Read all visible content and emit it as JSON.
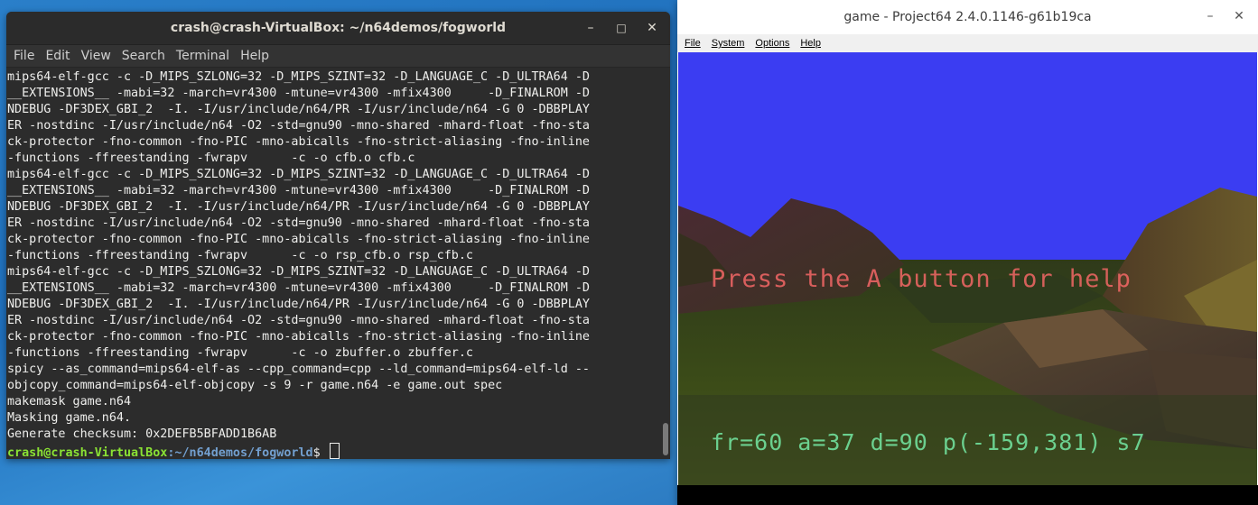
{
  "terminal": {
    "title": "crash@crash-VirtualBox: ~/n64demos/fogworld",
    "menu": [
      "File",
      "Edit",
      "View",
      "Search",
      "Terminal",
      "Help"
    ],
    "lines": [
      "mips64-elf-gcc -c -D_MIPS_SZLONG=32 -D_MIPS_SZINT=32 -D_LANGUAGE_C -D_ULTRA64 -D",
      "__EXTENSIONS__ -mabi=32 -march=vr4300 -mtune=vr4300 -mfix4300     -D_FINALROM -D",
      "NDEBUG -DF3DEX_GBI_2  -I. -I/usr/include/n64/PR -I/usr/include/n64 -G 0 -DBBPLAY",
      "ER -nostdinc -I/usr/include/n64 -O2 -std=gnu90 -mno-shared -mhard-float -fno-sta",
      "ck-protector -fno-common -fno-PIC -mno-abicalls -fno-strict-aliasing -fno-inline",
      "-functions -ffreestanding -fwrapv      -c -o cfb.o cfb.c",
      "mips64-elf-gcc -c -D_MIPS_SZLONG=32 -D_MIPS_SZINT=32 -D_LANGUAGE_C -D_ULTRA64 -D",
      "__EXTENSIONS__ -mabi=32 -march=vr4300 -mtune=vr4300 -mfix4300     -D_FINALROM -D",
      "NDEBUG -DF3DEX_GBI_2  -I. -I/usr/include/n64/PR -I/usr/include/n64 -G 0 -DBBPLAY",
      "ER -nostdinc -I/usr/include/n64 -O2 -std=gnu90 -mno-shared -mhard-float -fno-sta",
      "ck-protector -fno-common -fno-PIC -mno-abicalls -fno-strict-aliasing -fno-inline",
      "-functions -ffreestanding -fwrapv      -c -o rsp_cfb.o rsp_cfb.c",
      "mips64-elf-gcc -c -D_MIPS_SZLONG=32 -D_MIPS_SZINT=32 -D_LANGUAGE_C -D_ULTRA64 -D",
      "__EXTENSIONS__ -mabi=32 -march=vr4300 -mtune=vr4300 -mfix4300     -D_FINALROM -D",
      "NDEBUG -DF3DEX_GBI_2  -I. -I/usr/include/n64/PR -I/usr/include/n64 -G 0 -DBBPLAY",
      "ER -nostdinc -I/usr/include/n64 -O2 -std=gnu90 -mno-shared -mhard-float -fno-sta",
      "ck-protector -fno-common -fno-PIC -mno-abicalls -fno-strict-aliasing -fno-inline",
      "-functions -ffreestanding -fwrapv      -c -o zbuffer.o zbuffer.c",
      "spicy --as_command=mips64-elf-as --cpp_command=cpp --ld_command=mips64-elf-ld --",
      "objcopy_command=mips64-elf-objcopy -s 9 -r game.n64 -e game.out spec",
      "makemask game.n64",
      "Masking game.n64.",
      "Generate checksum: 0x2DEFB5BFADD1B6AB"
    ],
    "prompt_user": "crash@crash-VirtualBox",
    "prompt_path": ":~/n64demos/fogworld",
    "prompt_symbol": "$ "
  },
  "emulator": {
    "title": "game - Project64 2.4.0.1146-g61b19ca",
    "menu": [
      "File",
      "System",
      "Options",
      "Help"
    ],
    "help_text": "Press the A button for help",
    "stats_text": "fr=60 a=37 d=90 p(-159,381) s7",
    "sky_color": "#3b3df2"
  },
  "window_controls": {
    "minimize": "–",
    "maximize": "□",
    "close": "✕"
  }
}
